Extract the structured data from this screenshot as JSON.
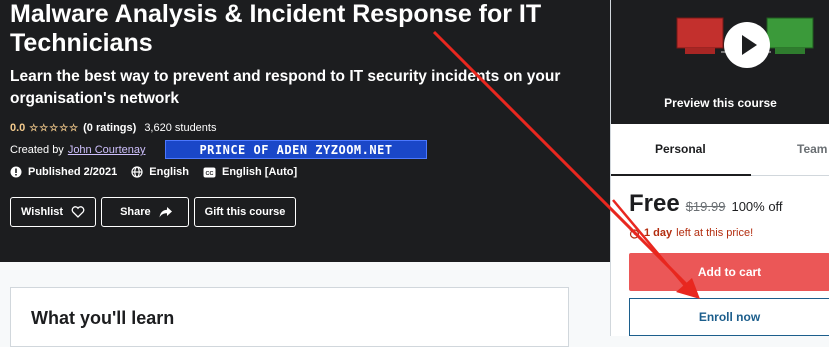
{
  "course": {
    "title": "Malware Analysis & Incident Response for IT Technicians",
    "subtitle": "Learn the best way to prevent and respond to IT security incidents on your organisation's network",
    "rating_value": "0.0",
    "stars": "☆☆☆☆☆",
    "rating_count": "(0 ratings)",
    "students": "3,620 students",
    "created_by_label": "Created by",
    "instructor": "John Courtenay",
    "banner_text": "PRINCE OF ADEN ZYZOOM.NET",
    "published": "Published 2/2021",
    "language": "English",
    "captions": "English [Auto]"
  },
  "actions": {
    "wishlist": "Wishlist",
    "share": "Share",
    "gift": "Gift this course"
  },
  "learn": {
    "title": "What you'll learn"
  },
  "sidebar": {
    "preview_label": "Preview this course",
    "tabs": [
      "Personal",
      "Team"
    ],
    "price": "Free",
    "original_price": "$19.99",
    "discount": "100% off",
    "timer_bold": "1 day",
    "timer_rest": "left at this price!",
    "add_to_cart": "Add to cart",
    "enroll_now": "Enroll now"
  },
  "colors": {
    "hero_bg": "#1c1d1f",
    "star": "#f3ca8c",
    "link": "#cec0fc",
    "cart": "#eb5757",
    "enroll_border": "#1c5e8c",
    "annotation_arrow": "#e8271f"
  }
}
